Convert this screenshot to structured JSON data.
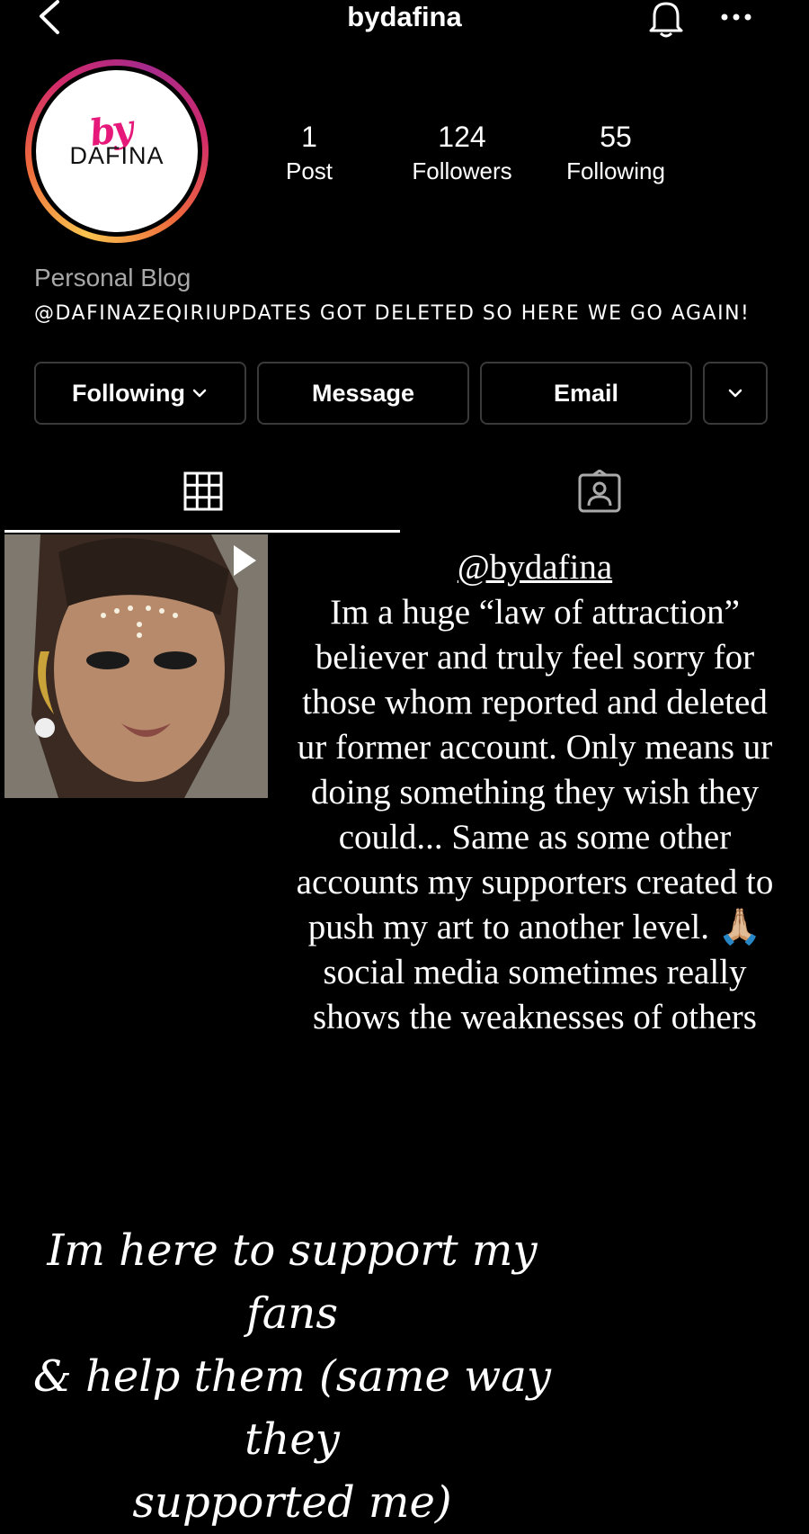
{
  "header": {
    "username": "bydafina",
    "back_icon": "chevron-left-icon",
    "bell_icon": "bell-icon",
    "more_icon": "more-horizontal-icon"
  },
  "profile": {
    "avatar_logo_by": "by",
    "avatar_logo_name": "DAFINA",
    "stats": [
      {
        "count": "1",
        "label": "Post"
      },
      {
        "count": "124",
        "label": "Followers"
      },
      {
        "count": "55",
        "label": "Following"
      }
    ],
    "category": "Personal Blog",
    "bio": "@DAFINAZEQIRIUPDATES GOT DELETED SO HERE WE GO AGAIN!"
  },
  "actions": {
    "following_label": "Following",
    "message_label": "Message",
    "email_label": "Email"
  },
  "tabs": {
    "grid_icon": "grid-icon",
    "tagged_icon": "tagged-person-icon"
  },
  "story": {
    "mention": "@bydafina",
    "body": "Im a huge “law of attraction” believer and truly feel sorry for those whom reported and deleted ur former account. Only means ur doing something they wish they could... Same as some other accounts my supporters created to push my art to another level. 🙏🏼 social media sometimes really shows the weaknesses of others",
    "script_line1": "Im here to support my fans",
    "script_line2": "& help them (same way they",
    "script_line3": "supported me)"
  },
  "colors": {
    "background": "#000000",
    "button_border": "#3a3a3a",
    "category_gray": "#a8a8a8",
    "ring_pink": "#d12a6a",
    "ring_orange": "#f9c44f",
    "logo_pink": "#e6197a"
  }
}
